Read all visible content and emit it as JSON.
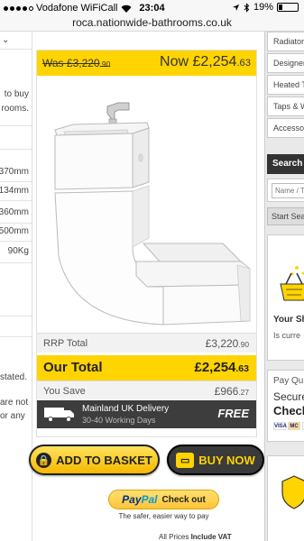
{
  "status_bar": {
    "carrier": "Vodafone WiFiCall",
    "time": "23:04",
    "battery": "19%",
    "battery_level": 0.19
  },
  "browser": {
    "url": "roca.nationwide-bathrooms.co.uk"
  },
  "left_column": {
    "lines": [
      "to buy",
      "rooms."
    ],
    "dimensions": [
      "370mm",
      "134mm",
      "360mm",
      "500mm",
      "90Kg"
    ],
    "stated": "stated.",
    "notes": [
      "are not",
      "or any"
    ]
  },
  "price_banner": {
    "was_label": "Was",
    "was_pounds": "£3,220",
    "was_pence": ".90",
    "now_label": "Now",
    "now_pounds": "£2,254",
    "now_pence": ".63"
  },
  "summary": {
    "rrp_label": "RRP Total",
    "rrp_pounds": "£3,220",
    "rrp_pence": ".90",
    "total_label": "Our Total",
    "total_pounds": "£2,254",
    "total_pence": ".63",
    "save_label": "You Save",
    "save_pounds": "£966",
    "save_pence": ".27"
  },
  "delivery": {
    "title": "Mainland UK Delivery",
    "subtitle": "30-40 Working Days",
    "price": "FREE"
  },
  "actions": {
    "basket_label": "ADD TO BASKET",
    "buy_label": "BUY NOW"
  },
  "paypal": {
    "brand_pay": "Pay",
    "brand_pal": "Pal",
    "cta": "Check out",
    "tagline": "The safer, easier way to pay"
  },
  "footer_note": {
    "text": "All Prices ",
    "bold": "Include VAT"
  },
  "sidebar": {
    "nav_items": [
      "Radiators",
      "Designer",
      "Heated T",
      "Taps & W",
      "Accesso"
    ],
    "search_title": "Search",
    "search_placeholder": "Name / T",
    "start_search": "Start Sea",
    "shop_title": "Your Sh",
    "shop_sub": "Is curre",
    "pay_line1": "Pay Qui",
    "pay_line2": "Secure",
    "pay_line3": "Check",
    "card_logos": [
      "VISA",
      "MC",
      "VE"
    ]
  },
  "colors": {
    "accent": "#ffd400",
    "dark": "#3d3d3d"
  }
}
